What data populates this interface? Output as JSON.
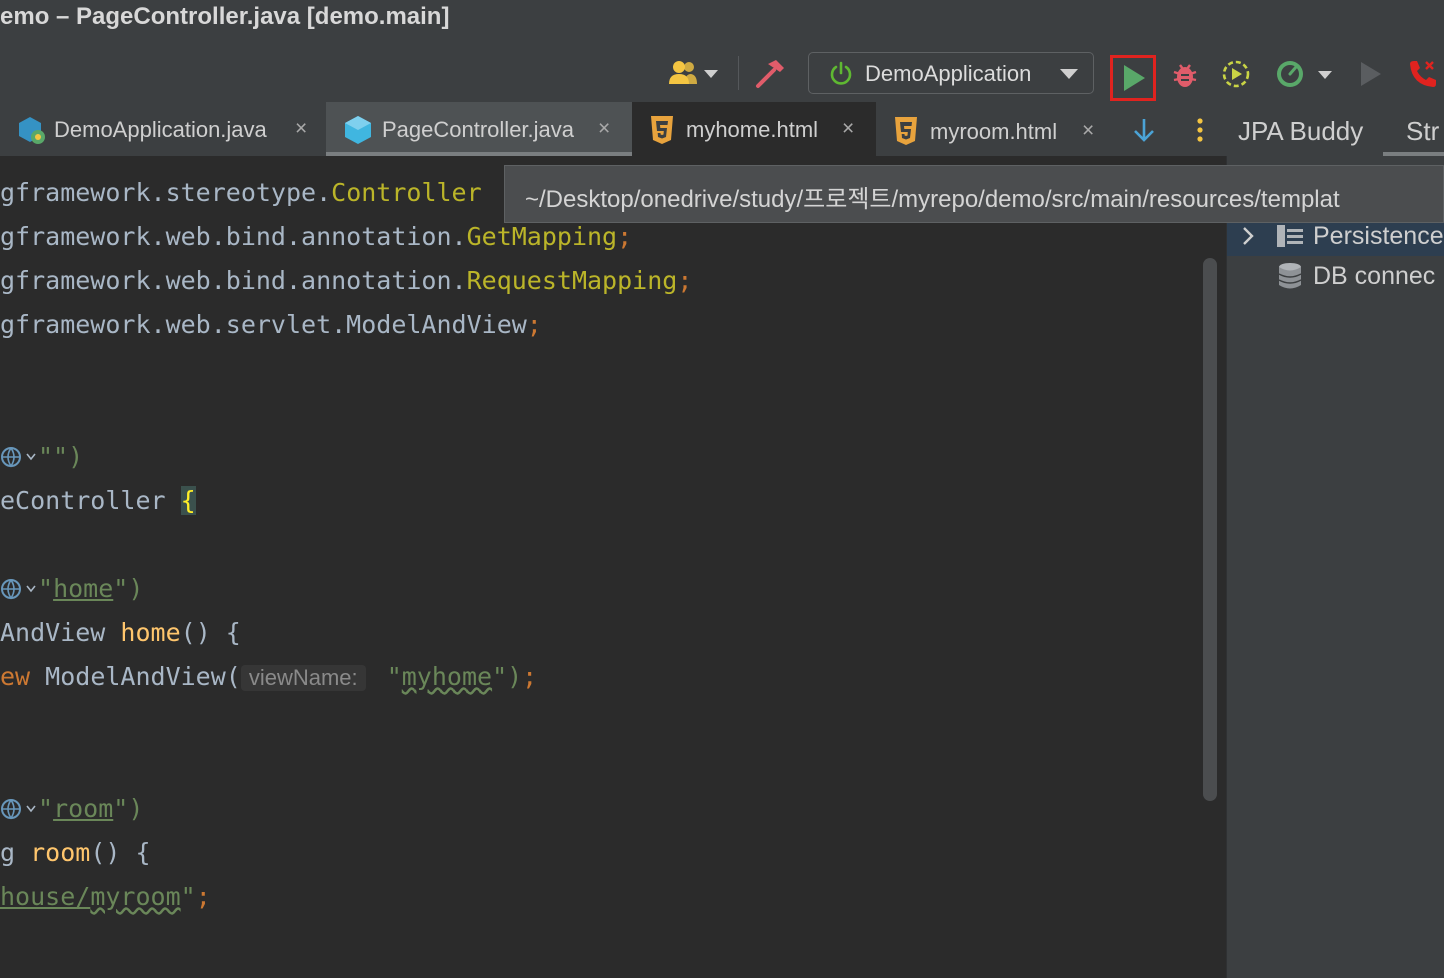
{
  "window": {
    "title": "emo – PageController.java [demo.main]"
  },
  "toolbar": {
    "run_config": "DemoApplication",
    "icons": [
      "users-icon",
      "hammer-icon",
      "power-icon",
      "run-icon",
      "debug-icon",
      "coverage-icon",
      "profiler-icon",
      "run-disabled-icon",
      "phone-icon"
    ],
    "accent_run": "#59a869",
    "highlight": "#e0231f"
  },
  "tabs": [
    {
      "label": "DemoApplication.java",
      "close": "×"
    },
    {
      "label": "PageController.java",
      "close": "×"
    },
    {
      "label": "myhome.html",
      "close": "×"
    },
    {
      "label": "myroom.html",
      "close": "×"
    }
  ],
  "right_tabs": {
    "jpa": "JPA Buddy",
    "structure": "Str"
  },
  "tooltip": {
    "path": "~/Desktop/onedrive/study/프로젝트/myrepo/demo/src/main/resources/templat"
  },
  "right_panel": {
    "items": [
      "Persistence",
      "DB connec"
    ]
  },
  "code": {
    "l1a": "gframework.stereotype.",
    "l1b": "Controller",
    "l2a": "gframework.web.bind.annotation.",
    "l2b": "GetMapping",
    "l2c": ";",
    "l3a": "gframework.web.bind.annotation.",
    "l3b": "RequestMapping",
    "l3c": ";",
    "l4a": "gframework.web.servlet.ModelAndView",
    "l4c": ";",
    "l5": "\"\")",
    "l6a": "eController ",
    "l6b": "{",
    "l7a": "\"",
    "l7b": "home",
    "l7c": "\")",
    "l8a": "AndView ",
    "l8b": "home",
    "l8c": "() {",
    "l9a": "ew",
    "l9b": " ModelAndView(",
    "l9hint": "viewName:",
    "l9c": " \"",
    "l9d": "myhome",
    "l9e": "\")",
    "l9f": ";",
    "l10a": "\"",
    "l10b": "room",
    "l10c": "\")",
    "l11a": "g ",
    "l11b": "room",
    "l11c": "() {",
    "l12a": "house/",
    "l12b": "myroom",
    "l12c": "\"",
    "l12d": ";"
  }
}
